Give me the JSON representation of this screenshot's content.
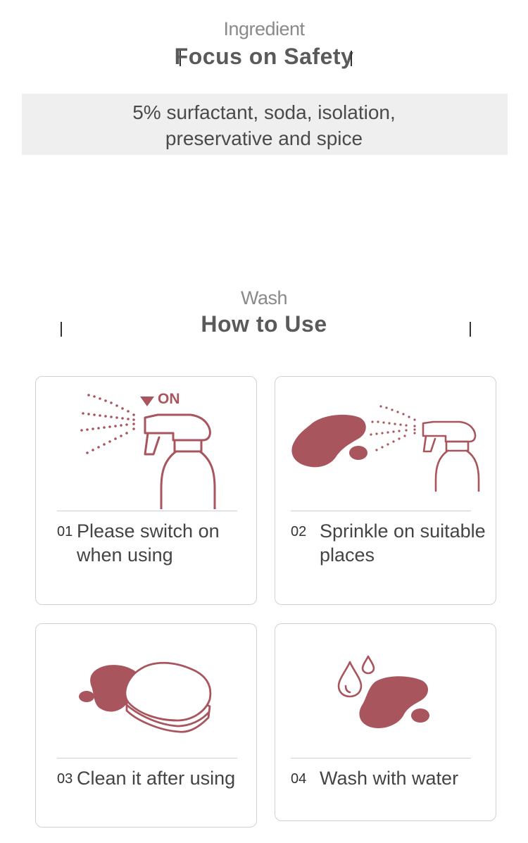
{
  "ingredient": {
    "subtitle": "Ingredient",
    "title": "Focus on Safety",
    "lines": [
      "5% surfactant, soda, isolation,",
      "preservative and spice"
    ]
  },
  "wash": {
    "subtitle": "Wash",
    "title": "How to Use"
  },
  "steps": [
    {
      "num": "01",
      "line1": "Please switch on",
      "line2": "when using",
      "icon": "spray-bottle-on-icon",
      "badge": "ON"
    },
    {
      "num": "02",
      "line1": "Sprinkle on suitable",
      "line2": "places",
      "icon": "spray-stain-icon"
    },
    {
      "num": "03",
      "line1": "Clean it after using",
      "line2": "",
      "icon": "sponge-stain-icon"
    },
    {
      "num": "04",
      "line1": "Wash with water",
      "line2": "",
      "icon": "water-drops-stain-icon"
    }
  ],
  "colors": {
    "accent": "#a8555e",
    "box_bg": "#efefef"
  }
}
